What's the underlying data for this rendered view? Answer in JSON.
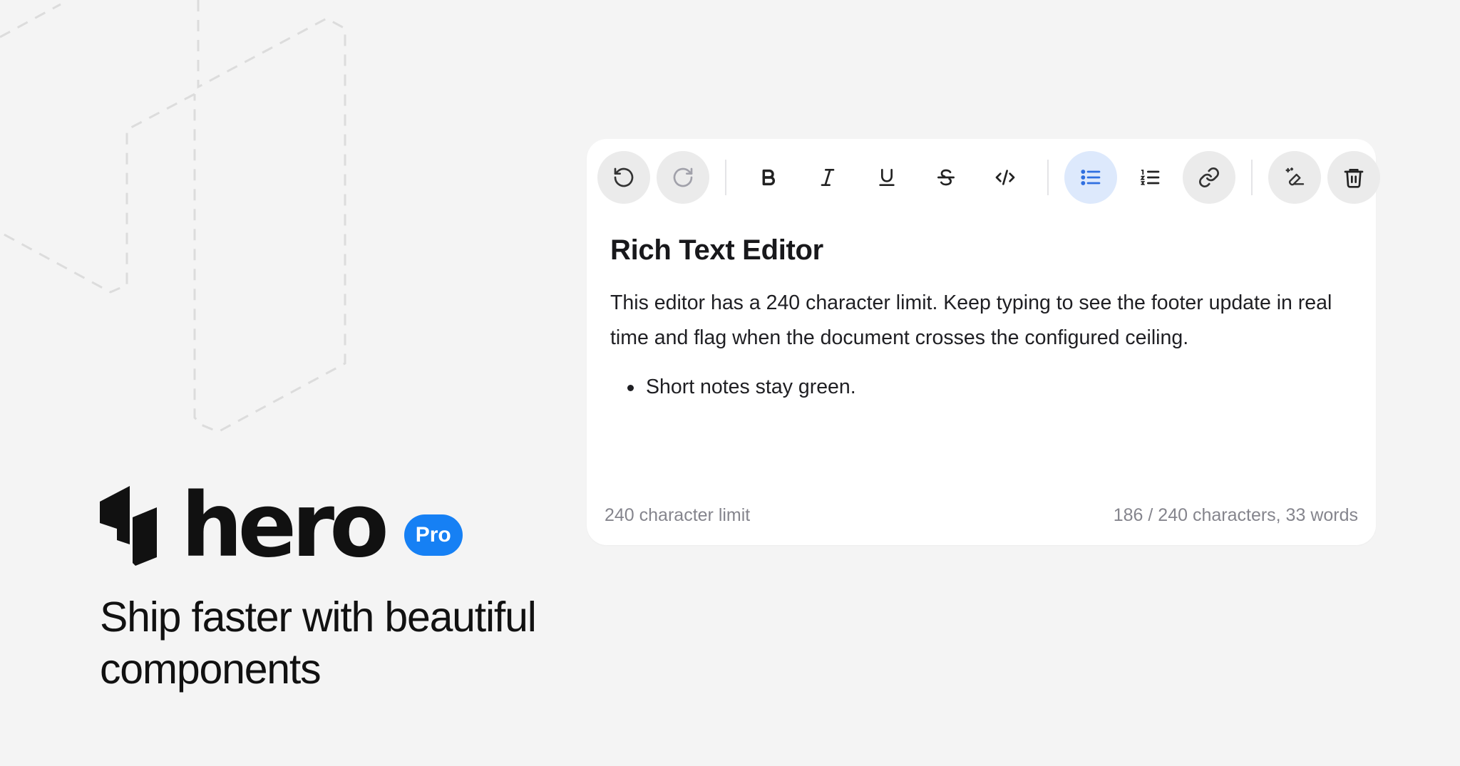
{
  "brand": {
    "wordmark": "hero",
    "badge": "Pro",
    "tagline": "Ship faster with beautiful components"
  },
  "editor": {
    "toolbar": [
      {
        "name": "undo",
        "icon": "undo-icon",
        "style": "filled"
      },
      {
        "name": "redo",
        "icon": "redo-icon",
        "style": "filled",
        "disabled": true
      },
      {
        "name": "bold",
        "icon": "bold-icon"
      },
      {
        "name": "italic",
        "icon": "italic-icon"
      },
      {
        "name": "underline",
        "icon": "underline-icon"
      },
      {
        "name": "strikethrough",
        "icon": "strikethrough-icon"
      },
      {
        "name": "code",
        "icon": "code-icon"
      },
      {
        "name": "bullet-list",
        "icon": "bullet-list-icon",
        "style": "active"
      },
      {
        "name": "ordered-list",
        "icon": "ordered-list-icon"
      },
      {
        "name": "link",
        "icon": "link-icon",
        "style": "filled"
      },
      {
        "name": "clear-formatting",
        "icon": "clear-formatting-icon",
        "style": "filled"
      },
      {
        "name": "delete",
        "icon": "trash-icon",
        "style": "filled"
      }
    ],
    "title": "Rich Text Editor",
    "paragraph": "This editor has a 240 character limit. Keep typing to see the footer update in real time and flag when the document crosses the configured ceiling.",
    "bullets": [
      "Short notes stay green."
    ],
    "footer": {
      "limit_label": "240 character limit",
      "count_label": "186 / 240 characters, 33 words"
    }
  },
  "colors": {
    "accent": "#1680f4",
    "active_bg": "#dde9fc",
    "active_icon": "#2f6fe0",
    "page_bg": "#f4f4f4"
  }
}
